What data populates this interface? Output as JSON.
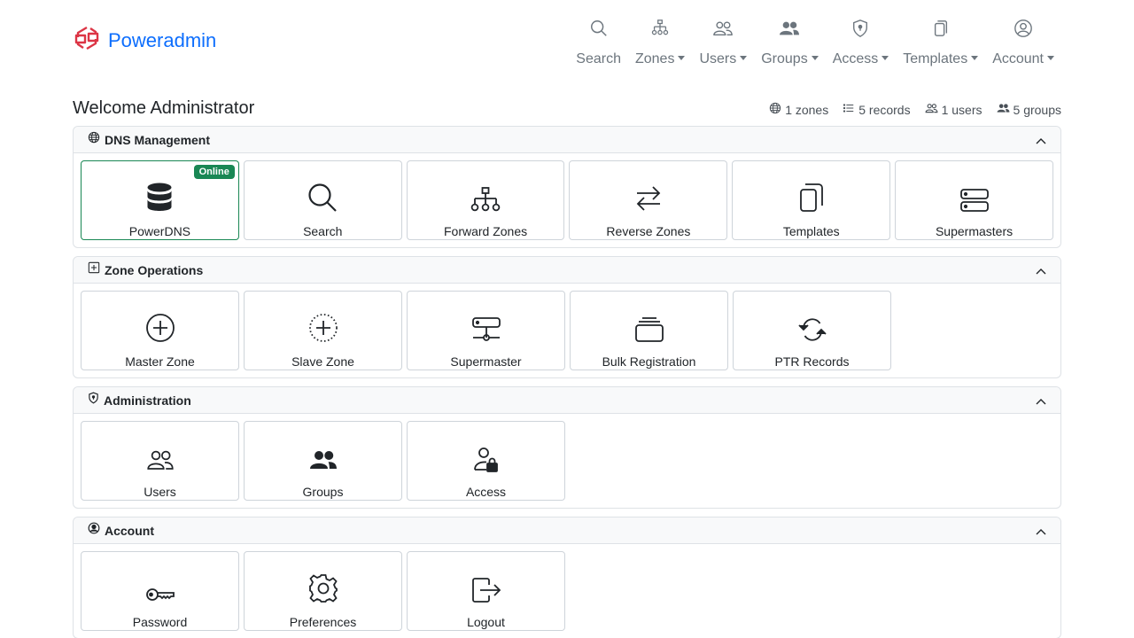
{
  "brand": {
    "name": "Poweradmin"
  },
  "nav": [
    {
      "label": "Search",
      "icon": "search-icon",
      "dropdown": false
    },
    {
      "label": "Zones",
      "icon": "diagram-icon",
      "dropdown": true
    },
    {
      "label": "Users",
      "icon": "people-icon",
      "dropdown": true
    },
    {
      "label": "Groups",
      "icon": "people-fill-icon",
      "dropdown": true
    },
    {
      "label": "Access",
      "icon": "shield-lock-icon",
      "dropdown": true
    },
    {
      "label": "Templates",
      "icon": "files-icon",
      "dropdown": true
    },
    {
      "label": "Account",
      "icon": "person-circle-icon",
      "dropdown": true
    }
  ],
  "welcome": "Welcome Administrator",
  "stats": {
    "zones": "1 zones",
    "records": "5 records",
    "users": "1 users",
    "groups": "5 groups"
  },
  "sections": [
    {
      "title": "DNS Management",
      "icon": "globe-icon",
      "tiles": [
        {
          "label": "PowerDNS",
          "icon": "database-icon",
          "badge": "Online"
        },
        {
          "label": "Search",
          "icon": "search-icon"
        },
        {
          "label": "Forward Zones",
          "icon": "diagram-icon"
        },
        {
          "label": "Reverse Zones",
          "icon": "arrow-left-right-icon"
        },
        {
          "label": "Templates",
          "icon": "files-icon"
        },
        {
          "label": "Supermasters",
          "icon": "hdd-stack-icon"
        }
      ]
    },
    {
      "title": "Zone Operations",
      "icon": "plus-square-icon",
      "tiles": [
        {
          "label": "Master Zone",
          "icon": "plus-circle-icon"
        },
        {
          "label": "Slave Zone",
          "icon": "plus-circle-dotted-icon"
        },
        {
          "label": "Supermaster",
          "icon": "hdd-network-icon"
        },
        {
          "label": "Bulk Registration",
          "icon": "collection-icon"
        },
        {
          "label": "PTR Records",
          "icon": "arrow-repeat-icon"
        }
      ]
    },
    {
      "title": "Administration",
      "icon": "shield-lock-icon",
      "tiles": [
        {
          "label": "Users",
          "icon": "people-icon"
        },
        {
          "label": "Groups",
          "icon": "people-fill-icon"
        },
        {
          "label": "Access",
          "icon": "person-lock-icon"
        }
      ]
    },
    {
      "title": "Account",
      "icon": "person-circle-icon",
      "tiles": [
        {
          "label": "Password",
          "icon": "key-icon"
        },
        {
          "label": "Preferences",
          "icon": "gear-icon"
        },
        {
          "label": "Logout",
          "icon": "box-arrow-right-icon"
        }
      ]
    }
  ],
  "colors": {
    "brand": "#0d6efd",
    "logo": "#dc3545",
    "online": "#198754"
  }
}
